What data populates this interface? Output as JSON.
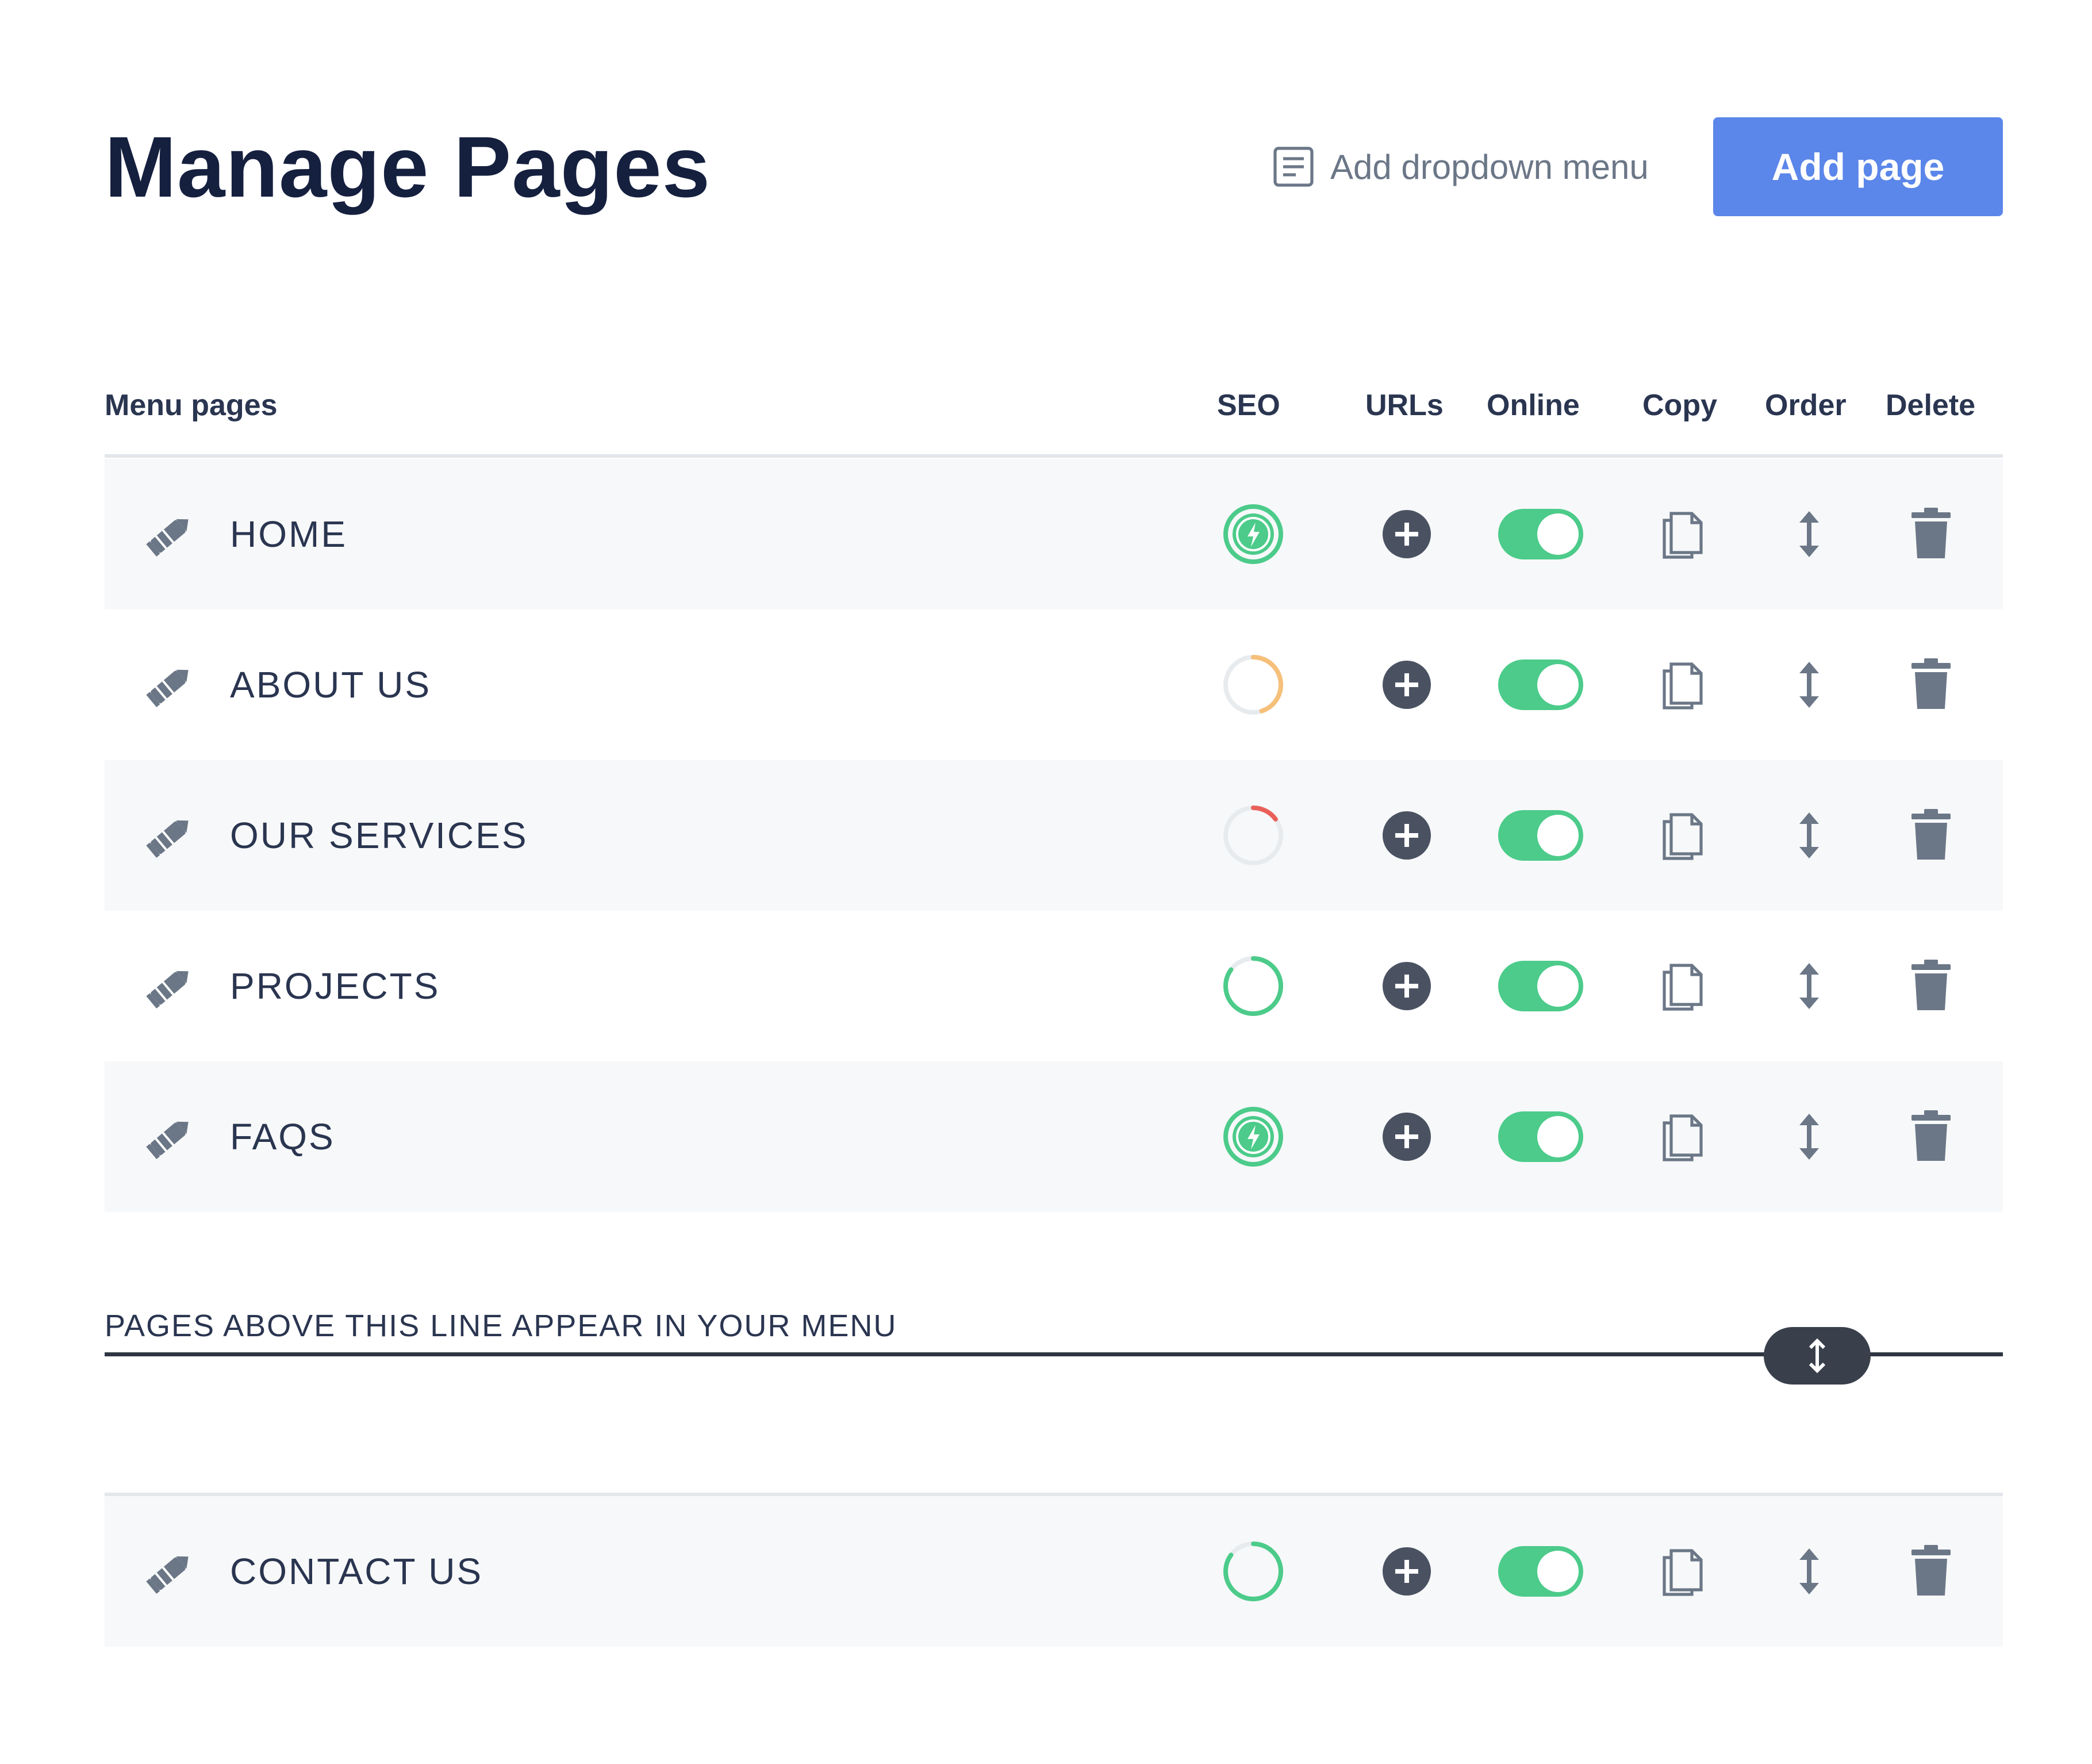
{
  "header": {
    "title": "Manage Pages",
    "dropdown_label": "Add dropdown menu",
    "add_page_label": "Add page"
  },
  "columns": {
    "menu_pages": "Menu pages",
    "seo": "SEO",
    "urls": "URLs",
    "online": "Online",
    "copy": "Copy",
    "order": "Order",
    "delete": "Delete"
  },
  "menu_pages": [
    {
      "label": "HOME",
      "seo": {
        "status": "complete",
        "progress": 1.0
      },
      "online": true
    },
    {
      "label": "ABOUT US",
      "seo": {
        "status": "partial",
        "progress": 0.45,
        "color": "#f6c07a"
      },
      "online": true
    },
    {
      "label": "OUR SERVICES",
      "seo": {
        "status": "low",
        "progress": 0.15,
        "color": "#e9605a"
      },
      "online": true
    },
    {
      "label": "PROJECTS",
      "seo": {
        "status": "partial",
        "progress": 0.85,
        "color": "#4ccb8a"
      },
      "online": true
    },
    {
      "label": "FAQS",
      "seo": {
        "status": "complete",
        "progress": 1.0
      },
      "online": true
    }
  ],
  "divider": {
    "text": "PAGES ABOVE THIS LINE APPEAR IN YOUR MENU"
  },
  "other_pages": [
    {
      "label": "CONTACT US",
      "seo": {
        "status": "partial",
        "progress": 0.85,
        "color": "#4ccb8a"
      },
      "online": true
    }
  ],
  "colors": {
    "accent": "#5b86ea",
    "success": "#4ccb8a",
    "warning": "#f6c07a",
    "danger": "#e9605a",
    "icon": "#6b7787",
    "dark": "#39404c"
  },
  "icons": {
    "edit": "pencil-icon",
    "seo_complete": "lightning-circle-icon",
    "add_url": "plus-circle-icon",
    "copy": "copy-icon",
    "order": "vertical-arrows-icon",
    "delete": "trash-icon",
    "dropdown": "list-icon"
  }
}
